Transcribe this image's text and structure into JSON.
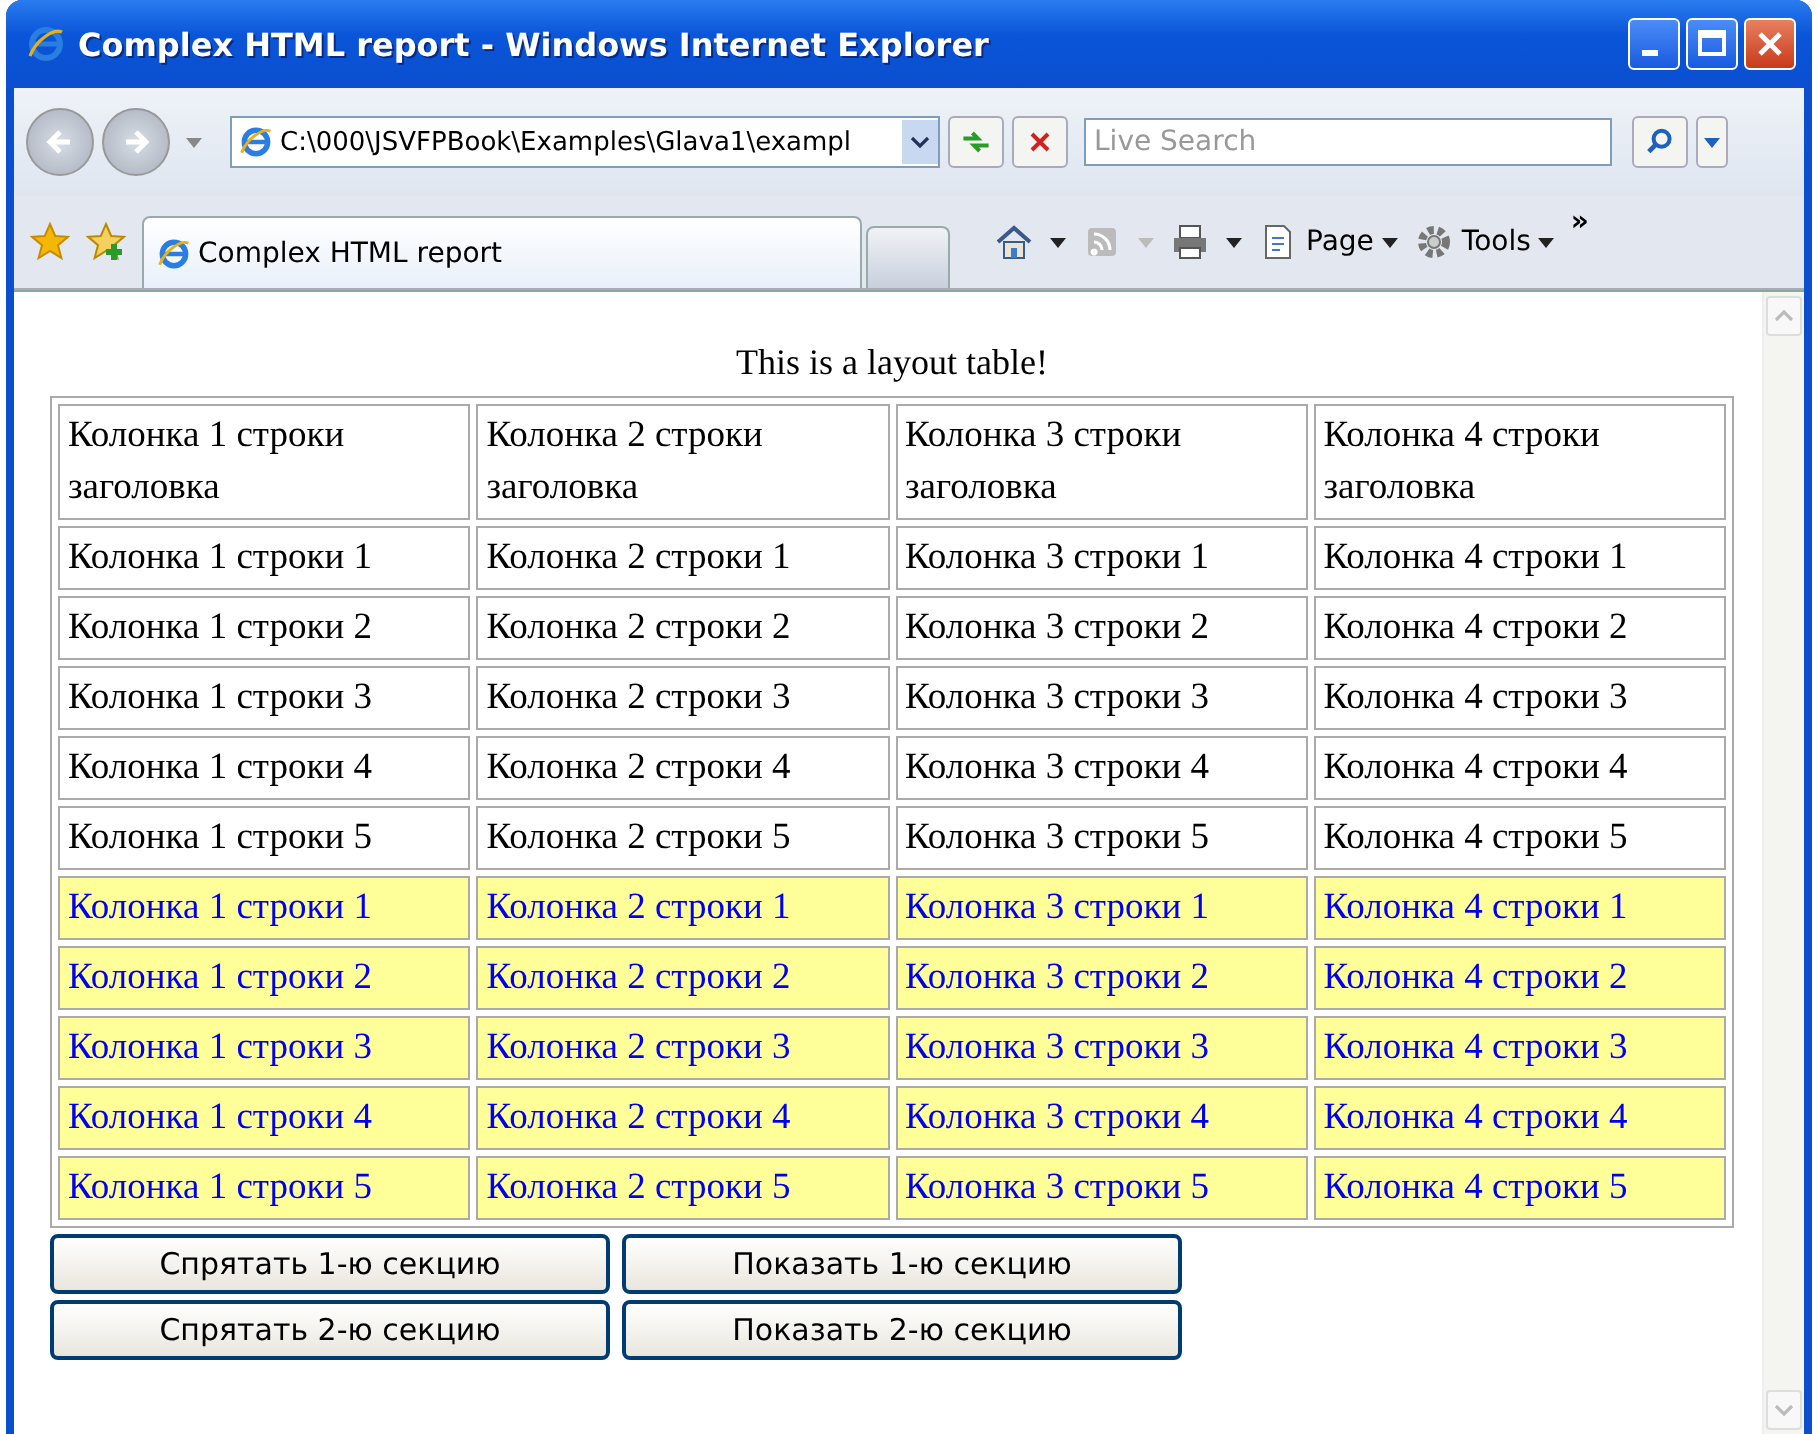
{
  "window": {
    "title": "Complex HTML report - Windows Internet Explorer"
  },
  "address_bar": {
    "value": "C:\\000\\JSVFPBook\\Examples\\Glava1\\exampl"
  },
  "search": {
    "placeholder": "Live Search"
  },
  "tabs": [
    {
      "label": "Complex HTML report",
      "selected": true
    }
  ],
  "command_bar": [
    {
      "label": "Page"
    },
    {
      "label": "Tools"
    }
  ],
  "more": "»",
  "table": {
    "caption": "This is a layout table!",
    "header": [
      "Колонка 1 строки заголовка",
      "Колонка 2 строки заголовка",
      "Колонка 3 строки заголовка",
      "Колонка 4 строки заголовка"
    ],
    "sections": [
      {
        "kind": "plain",
        "rows": [
          [
            "Колонка 1 строки 1",
            "Колонка 2 строки 1",
            "Колонка 3 строки 1",
            "Колонка 4 строки 1"
          ],
          [
            "Колонка 1 строки 2",
            "Колонка 2 строки 2",
            "Колонка 3 строки 2",
            "Колонка 4 строки 2"
          ],
          [
            "Колонка 1 строки 3",
            "Колонка 2 строки 3",
            "Колонка 3 строки 3",
            "Колонка 4 строки 3"
          ],
          [
            "Колонка 1 строки 4",
            "Колонка 2 строки 4",
            "Колонка 3 строки 4",
            "Колонка 4 строки 4"
          ],
          [
            "Колонка 1 строки 5",
            "Колонка 2 строки 5",
            "Колонка 3 строки 5",
            "Колонка 4 строки 5"
          ]
        ]
      },
      {
        "kind": "highlighted",
        "rows": [
          [
            "Колонка 1 строки 1",
            "Колонка 2 строки 1",
            "Колонка 3 строки 1",
            "Колонка 4 строки 1"
          ],
          [
            "Колонка 1 строки 2",
            "Колонка 2 строки 2",
            "Колонка 3 строки 2",
            "Колонка 4 строки 2"
          ],
          [
            "Колонка 1 строки 3",
            "Колонка 2 строки 3",
            "Колонка 3 строки 3",
            "Колонка 4 строки 3"
          ],
          [
            "Колонка 1 строки 4",
            "Колонка 2 строки 4",
            "Колонка 3 строки 4",
            "Колонка 4 строки 4"
          ],
          [
            "Колонка 1 строки 5",
            "Колонка 2 строки 5",
            "Колонка 3 строки 5",
            "Колонка 4 строки 5"
          ]
        ]
      }
    ]
  },
  "buttons": [
    [
      "Спрятать 1-ю секцию",
      "Показать 1-ю секцию"
    ],
    [
      "Спрятать 2-ю секцию",
      "Показать 2-ю секцию"
    ]
  ]
}
